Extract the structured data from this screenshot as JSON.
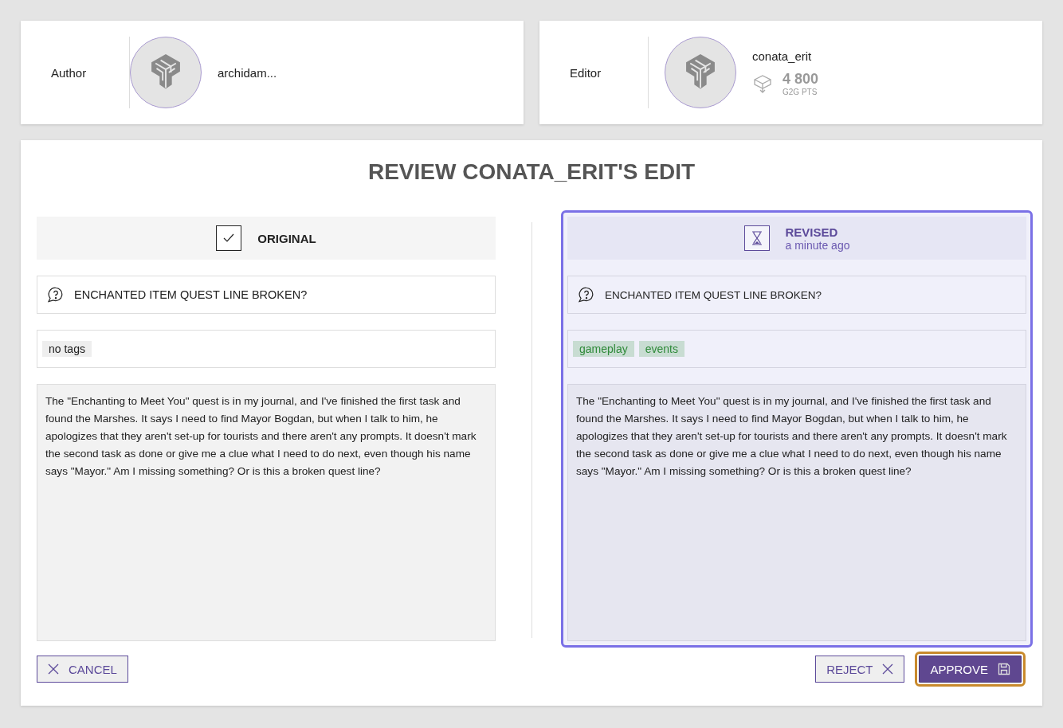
{
  "author": {
    "label": "Author",
    "name": "archidam..."
  },
  "editor": {
    "label": "Editor",
    "name": "conata_erit",
    "points": "4 800",
    "points_unit": "G2G PTS"
  },
  "title": "REVIEW CONATA_ERIT'S EDIT",
  "versions": [
    {
      "kind": "original",
      "label": "ORIGINAL",
      "selected": false,
      "question": "ENCHANTED ITEM QUEST LINE BROKEN?",
      "tags": [
        {
          "text": "no tags",
          "kind": "empty"
        }
      ],
      "body": "The \"Enchanting to Meet You\" quest is in my journal, and I've finished the first task and found the Marshes. It says I need to find Mayor Bogdan, but when I talk to him, he apologizes that they aren't set-up for tourists and there aren't any prompts. It doesn't mark the second task as done or give me a clue what I need to do next, even though his name says \"Mayor.\" Am I missing something? Or is this a broken quest line?"
    },
    {
      "kind": "revised",
      "label": "REVISED",
      "time": "a minute ago",
      "selected": true,
      "question": "ENCHANTED ITEM QUEST LINE BROKEN?",
      "tags": [
        {
          "text": "gameplay",
          "kind": "tag"
        },
        {
          "text": "events",
          "kind": "tag"
        }
      ],
      "body": "The \"Enchanting to Meet You\" quest is in my journal, and I've finished the first task and found the Marshes. It says I need to find Mayor Bogdan, but when I talk to him, he apologizes that they aren't set-up for tourists and there aren't any prompts. It doesn't mark the second task as done or give me a clue what I need to do next, even though his name says \"Mayor.\" Am I missing something? Or is this a broken quest line?"
    }
  ],
  "buttons": [
    {
      "kind": "cancel",
      "label": "CANCEL",
      "focused": false
    },
    {
      "kind": "reject",
      "label": "REJECT",
      "focused": false
    },
    {
      "kind": "approve",
      "label": "APPROVE",
      "focused": true
    }
  ]
}
